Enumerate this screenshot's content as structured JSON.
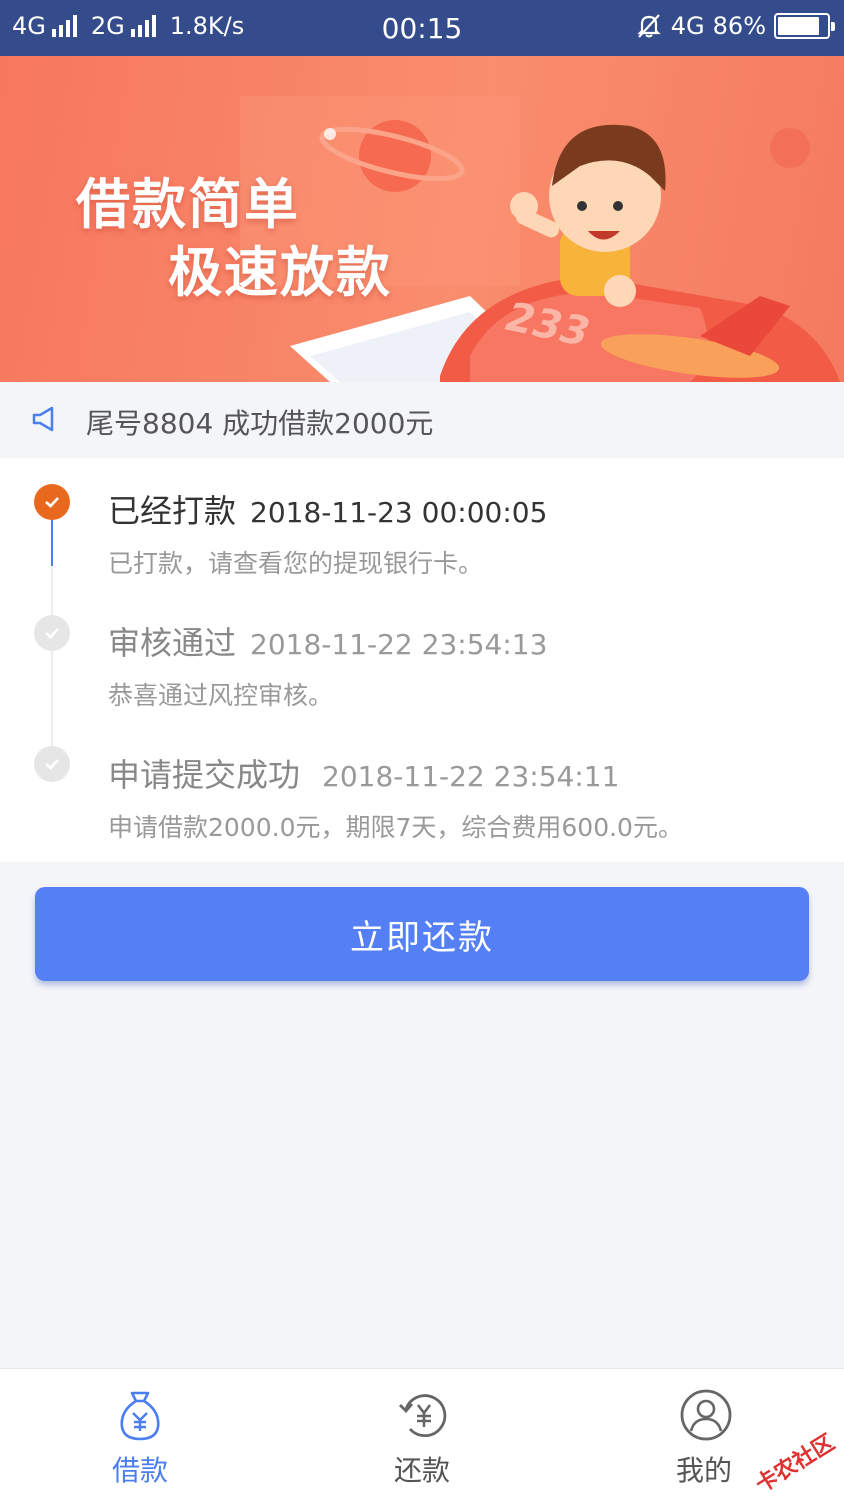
{
  "status_bar": {
    "net1": "4G",
    "net2": "2G",
    "speed": "1.8K/s",
    "time": "00:15",
    "net3": "4G",
    "battery_percent": "86%",
    "battery_level": 0.86
  },
  "banner": {
    "title": "借款简单",
    "subtitle": "极速放款",
    "plane_number": "233"
  },
  "notice": {
    "text": "尾号8804 成功借款2000元"
  },
  "timeline": {
    "steps": [
      {
        "title": "已经打款",
        "time": "2018-11-23 00:00:05",
        "desc": "已打款，请查看您的提现银行卡。",
        "state": "active"
      },
      {
        "title": "审核通过",
        "time": "2018-11-22 23:54:13",
        "desc": "恭喜通过风控审核。",
        "state": "done"
      },
      {
        "title": "申请提交成功",
        "time": "2018-11-22 23:54:11",
        "desc": "申请借款2000.0元，期限7天，综合费用600.0元。",
        "state": "done"
      }
    ]
  },
  "repay_button": {
    "label": "立即还款"
  },
  "tabbar": {
    "items": [
      {
        "label": "借款",
        "icon": "money-bag-icon",
        "active": true
      },
      {
        "label": "还款",
        "icon": "repay-yen-icon",
        "active": false
      },
      {
        "label": "我的",
        "icon": "user-icon",
        "active": false
      }
    ]
  },
  "watermark": "卡农社区",
  "colors": {
    "status_bar": "#354c8c",
    "accent_blue": "#547ff5",
    "active_step": "#e8681e",
    "tab_active": "#4c7ef0"
  }
}
